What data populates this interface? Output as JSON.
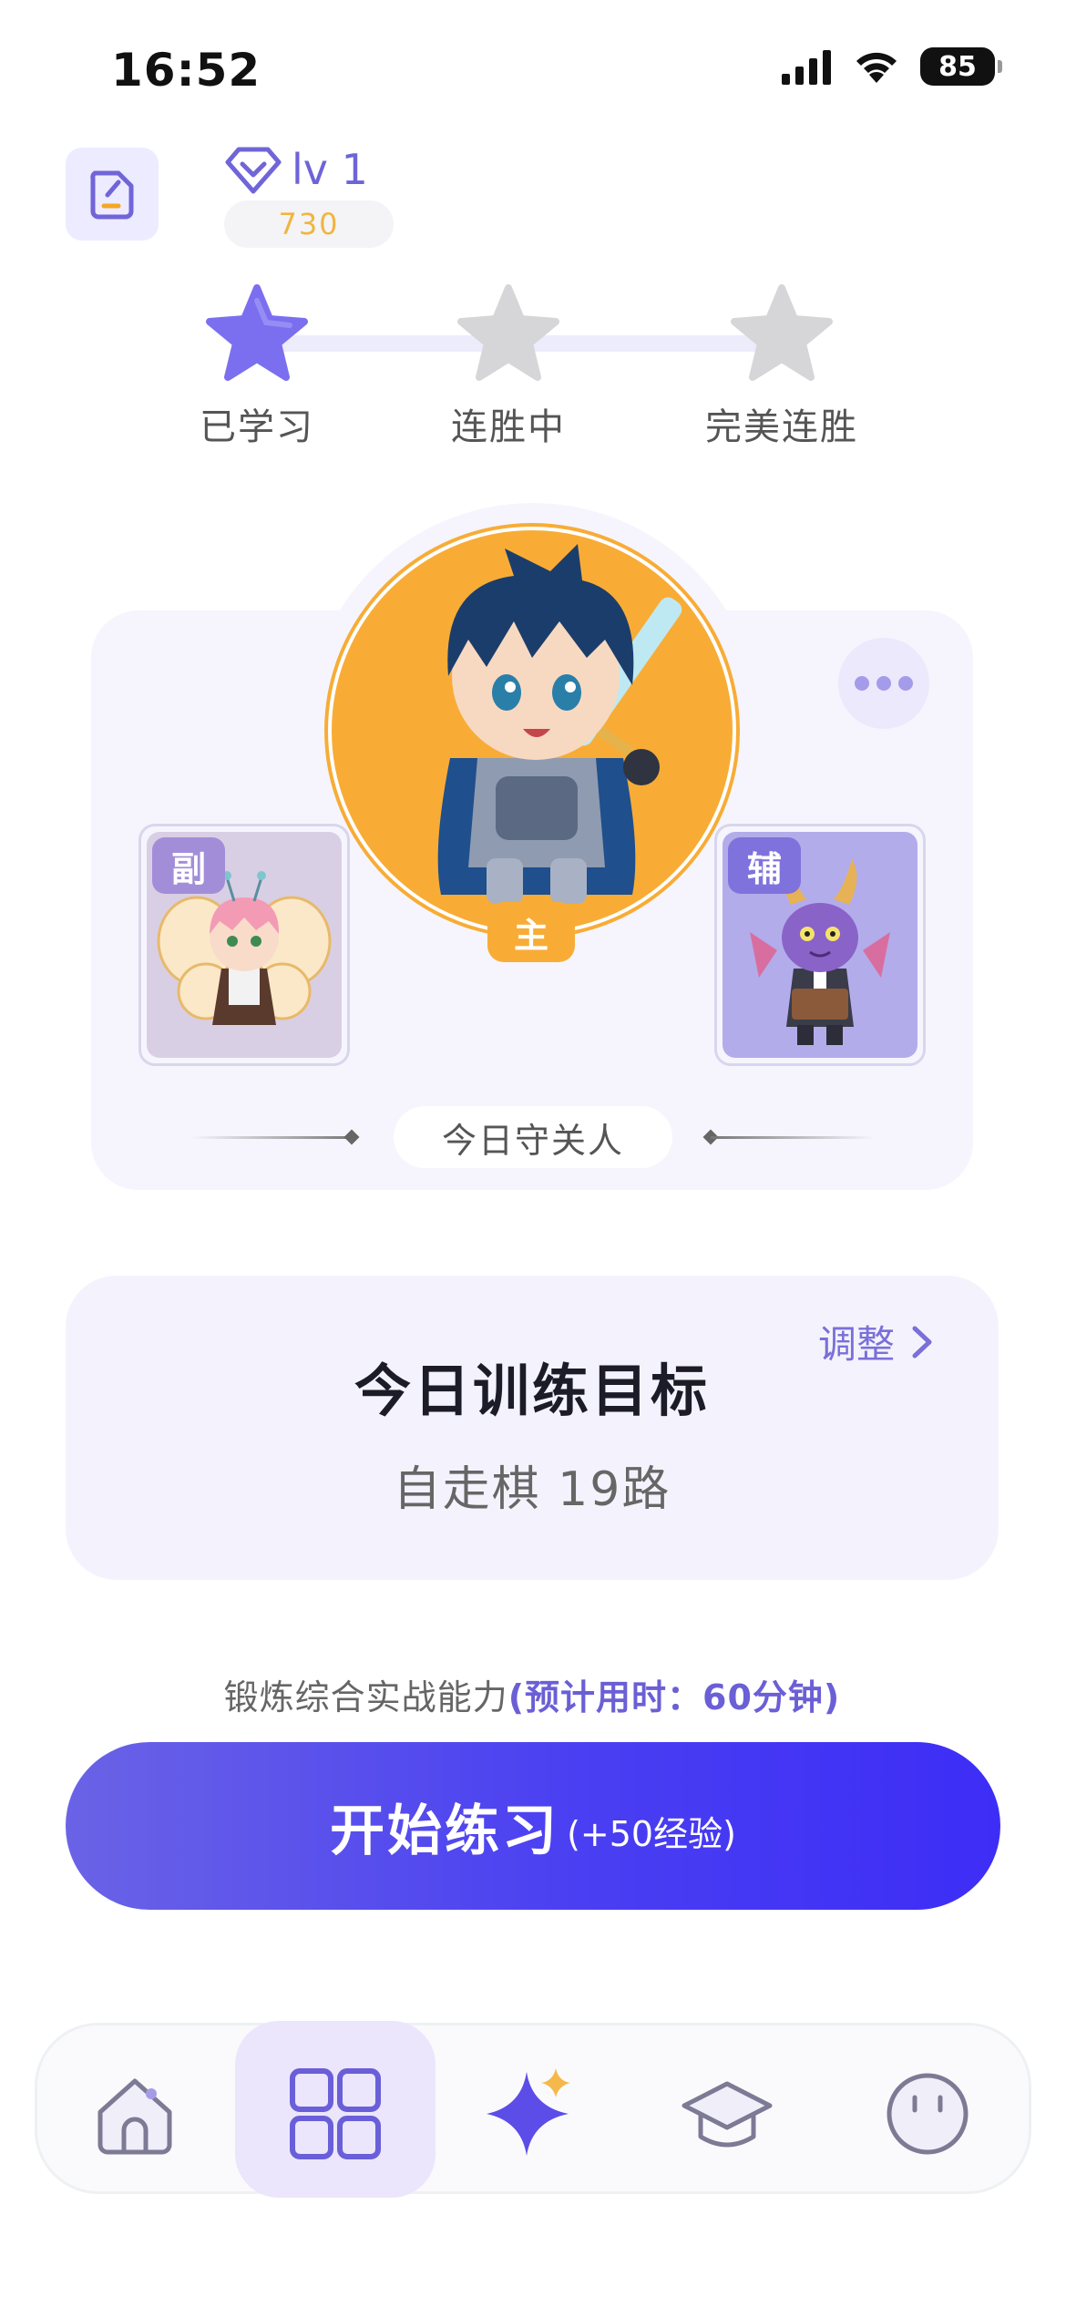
{
  "status_bar": {
    "time": "16:52",
    "battery": "85"
  },
  "header": {
    "edit_icon": "edit-document-icon",
    "level": "lv 1",
    "xp": "730"
  },
  "progress": {
    "steps": [
      {
        "label": "已学习",
        "active": true
      },
      {
        "label": "连胜中",
        "active": false
      },
      {
        "label": "完美连胜",
        "active": false
      }
    ],
    "active_color": "#7b6ff0",
    "inactive_color": "#d6d6d8"
  },
  "guardian": {
    "main_badge": "主",
    "left_tag": "副",
    "right_tag": "辅",
    "label": "今日守关人",
    "main_color": "#f8ac36",
    "left_bg": "#d9cfe4",
    "right_bg": "#b3aceb"
  },
  "training": {
    "adjust_label": "调整",
    "title": "今日训练目标",
    "subtitle": "自走棋  19路"
  },
  "hint": {
    "text": "锻炼综合实战能力",
    "highlight": "(预计用时：60分钟)"
  },
  "start": {
    "label": "开始练习",
    "bonus": "(+50经验)"
  },
  "tabs": [
    {
      "name": "home-icon",
      "active": false
    },
    {
      "name": "grid-icon",
      "active": true
    },
    {
      "name": "sparkle-icon",
      "active": false
    },
    {
      "name": "graduation-cap-icon",
      "active": false
    },
    {
      "name": "profile-icon",
      "active": false
    }
  ]
}
